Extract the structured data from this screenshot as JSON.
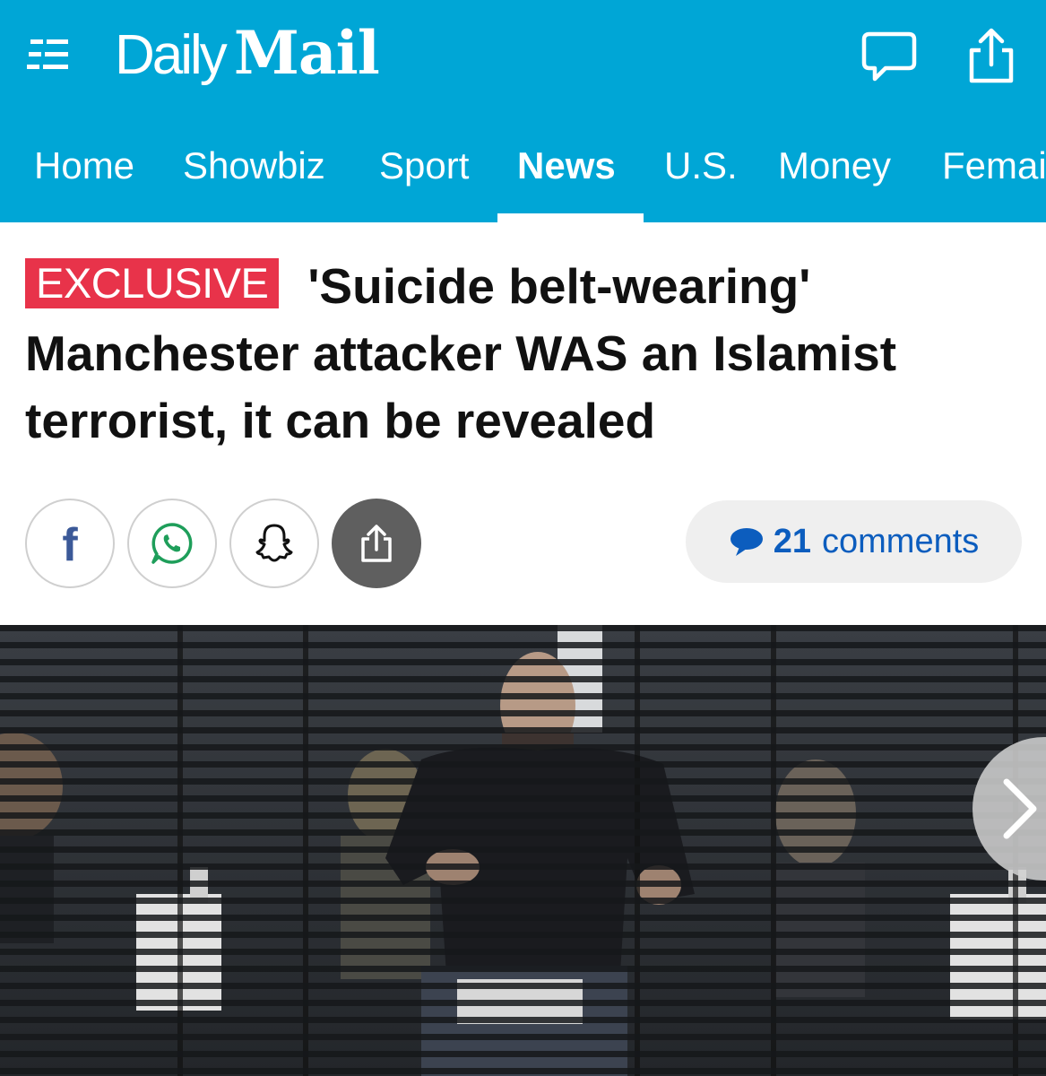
{
  "header": {
    "logo": {
      "daily": "Daily",
      "mail": "Mail"
    },
    "icons": {
      "menu": "hamburger-menu-icon",
      "comments": "speech-bubble-icon",
      "share": "share-icon"
    },
    "brand_color": "#00a6d6"
  },
  "nav": {
    "items": [
      {
        "label": "Home",
        "active": false
      },
      {
        "label": "Showbiz",
        "active": false
      },
      {
        "label": "Sport",
        "active": false
      },
      {
        "label": "News",
        "active": true
      },
      {
        "label": "U.S.",
        "active": false
      },
      {
        "label": "Money",
        "active": false
      },
      {
        "label": "Femai",
        "active": false
      }
    ]
  },
  "article": {
    "badge": "EXCLUSIVE",
    "badge_color": "#e8334a",
    "headline": "'Suicide belt-wearing' Manchester attacker WAS an Islamist terrorist, it can be revealed"
  },
  "share": {
    "buttons": [
      "facebook-icon",
      "whatsapp-icon",
      "snapchat-icon",
      "share-icon"
    ],
    "facebook_glyph": "f"
  },
  "comments": {
    "count": "21",
    "label": "comments",
    "color": "#0c5dbe"
  },
  "photo": {
    "description_icon": "next-arrow-icon"
  }
}
